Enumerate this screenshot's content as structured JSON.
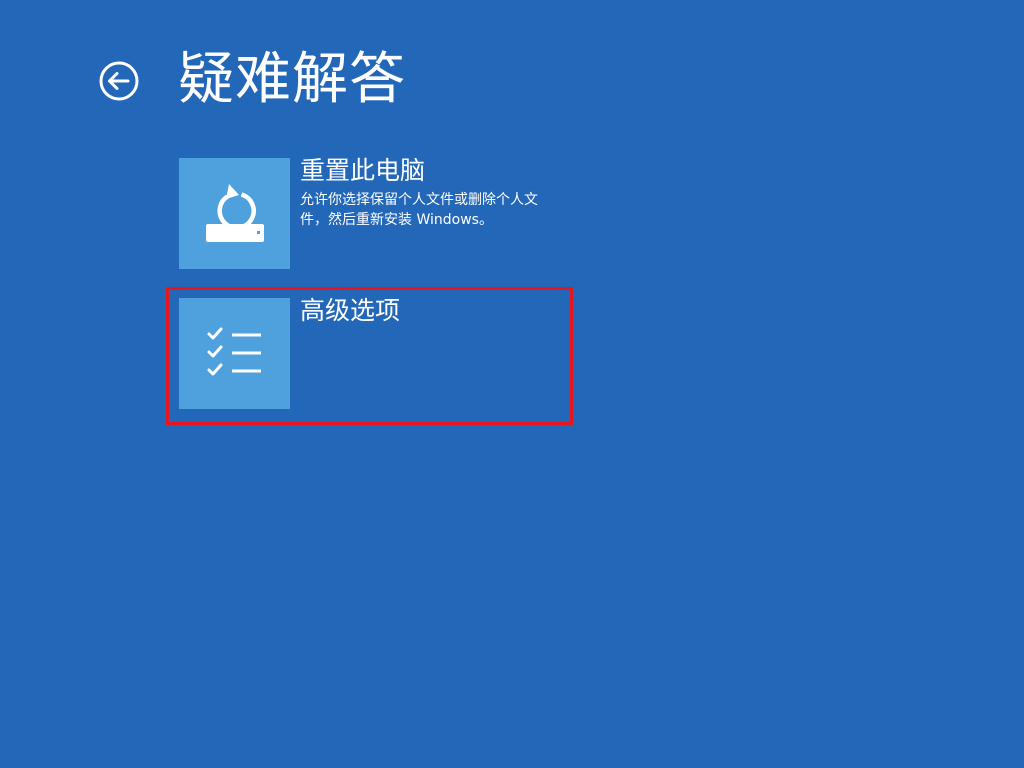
{
  "header": {
    "back_icon": "back-arrow-circle-icon",
    "title": "疑难解答"
  },
  "options": [
    {
      "icon": "reset-pc-icon",
      "title": "重置此电脑",
      "description": "允许你选择保留个人文件或删除个人文件，然后重新安装 Windows。"
    },
    {
      "icon": "checklist-icon",
      "title": "高级选项",
      "description": ""
    }
  ],
  "colors": {
    "background": "#2367b8",
    "tile": "#4ea1dd",
    "text": "#ffffff",
    "highlight": "#e8151f"
  }
}
